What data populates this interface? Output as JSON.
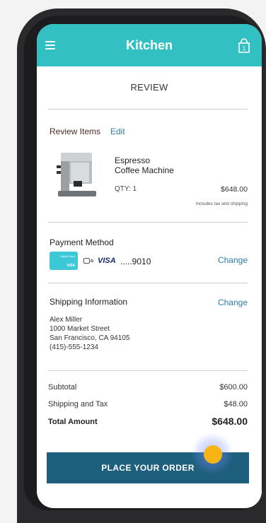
{
  "header": {
    "title": "Kitchen",
    "cart_count": "1"
  },
  "review": {
    "heading": "REVIEW"
  },
  "items_section": {
    "label": "Review Items",
    "edit_label": "Edit",
    "product": {
      "name_line1": "Espresso",
      "name_line2": "Coffee Machine",
      "qty": "QTY: 1",
      "price": "$648.00",
      "note": "Includes tax and shipping"
    }
  },
  "payment": {
    "label": "Payment Method",
    "card_brand": "VISA",
    "card_number": ".....9010",
    "change_label": "Change"
  },
  "shipping": {
    "label": "Shipping Information",
    "change_label": "Change",
    "address": [
      "Alex Miller",
      "1000 Market Street",
      "San Francisco, CA 94105",
      "(415)-555-1234"
    ]
  },
  "summary": {
    "subtotal_label": "Subtotal",
    "subtotal_value": "$600.00",
    "shipping_tax_label": "Shipping and Tax",
    "shipping_tax_value": "$48.00",
    "total_label": "Total Amount",
    "total_value": "$648.00"
  },
  "cta": {
    "label": "PLACE YOUR ORDER"
  },
  "colors": {
    "header": "#33c0c3",
    "button": "#1e5f7e",
    "link": "#2e7ca6",
    "tap": "#f7b515"
  }
}
